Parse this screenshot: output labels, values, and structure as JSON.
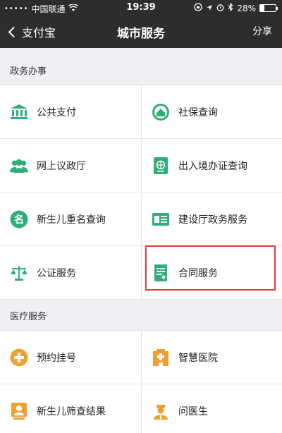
{
  "status_bar": {
    "signal": "•••••",
    "carrier": "中国联通",
    "wifi": "wifi",
    "time": "19:39",
    "battery_text": "28%",
    "battery_level": 0.28
  },
  "nav": {
    "back_label": "支付宝",
    "title": "城市服务",
    "share_label": "分享"
  },
  "sections": [
    {
      "title": "政务办事",
      "items": [
        {
          "label": "公共支付",
          "icon": "bank-icon"
        },
        {
          "label": "社保查询",
          "icon": "home-shield-icon"
        },
        {
          "label": "网上议政厅",
          "icon": "people-icon"
        },
        {
          "label": "出入境办证查询",
          "icon": "passport-icon"
        },
        {
          "label": "新生儿重名查询",
          "icon": "name-badge-icon"
        },
        {
          "label": "建设厅政务服务",
          "icon": "id-card-icon"
        },
        {
          "label": "公证服务",
          "icon": "scales-icon"
        },
        {
          "label": "合同服务",
          "icon": "document-icon"
        }
      ]
    },
    {
      "title": "医疗服务",
      "items": [
        {
          "label": "预约挂号",
          "icon": "medical-cross-icon"
        },
        {
          "label": "智慧医院",
          "icon": "hospital-icon"
        },
        {
          "label": "新生儿筛查结果",
          "icon": "baby-icon"
        },
        {
          "label": "问医生",
          "icon": "doctor-icon"
        }
      ]
    }
  ],
  "colors": {
    "header_bg": "#2d2d2f",
    "green": "#2fae7a",
    "orange": "#f0a030",
    "highlight": "#e8393a"
  }
}
